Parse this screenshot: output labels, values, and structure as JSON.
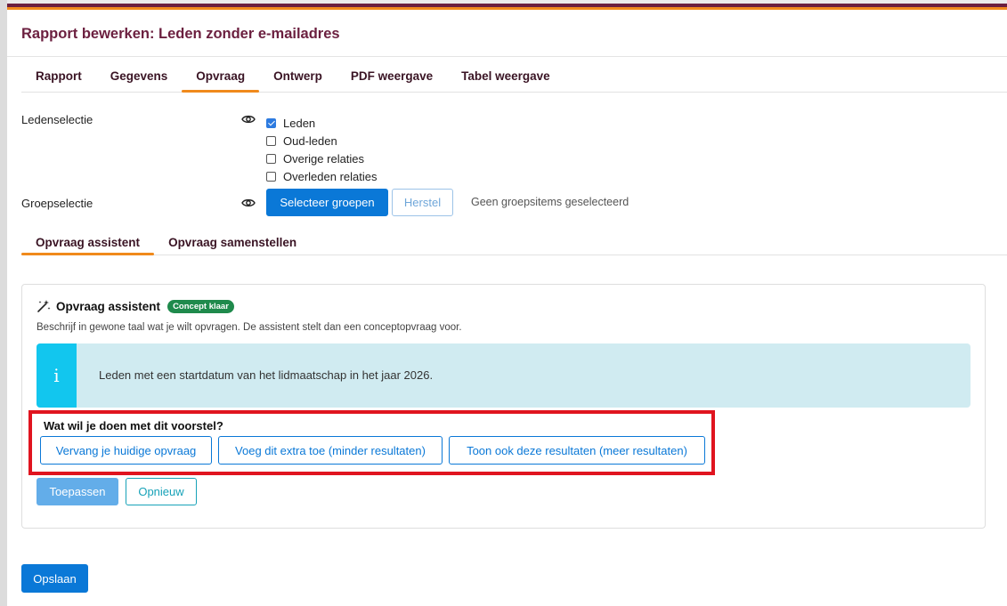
{
  "header": {
    "title": "Rapport bewerken: Leden zonder e-mailadres"
  },
  "tabs": [
    {
      "label": "Rapport"
    },
    {
      "label": "Gegevens"
    },
    {
      "label": "Opvraag",
      "active": true
    },
    {
      "label": "Ontwerp"
    },
    {
      "label": "PDF weergave"
    },
    {
      "label": "Tabel weergave"
    }
  ],
  "ledenselectie": {
    "label": "Ledenselectie",
    "options": [
      {
        "label": "Leden",
        "checked": true
      },
      {
        "label": "Oud-leden",
        "checked": false
      },
      {
        "label": "Overige relaties",
        "checked": false
      },
      {
        "label": "Overleden relaties",
        "checked": false
      }
    ]
  },
  "groepselectie": {
    "label": "Groepselectie",
    "select_button": "Selecteer groepen",
    "reset_button": "Herstel",
    "status": "Geen groepsitems geselecteerd"
  },
  "subtabs": [
    {
      "label": "Opvraag assistent",
      "active": true
    },
    {
      "label": "Opvraag samenstellen"
    }
  ],
  "assistant": {
    "title": "Opvraag assistent",
    "badge": "Concept klaar",
    "description": "Beschrijf in gewone taal wat je wilt opvragen. De assistent stelt dan een conceptopvraag voor.",
    "info_text": "Leden met een startdatum van het lidmaatschap in het jaar 2026.",
    "question": "Wat wil je doen met dit voorstel?",
    "choices": [
      "Vervang je huidige opvraag",
      "Voeg dit extra toe (minder resultaten)",
      "Toon ook deze resultaten (meer resultaten)"
    ],
    "apply_button": "Toepassen",
    "retry_button": "Opnieuw"
  },
  "save_button": "Opslaan",
  "colors": {
    "brand": "#6b1f3f",
    "accent": "#f08a1c",
    "primary": "#0a78d7",
    "info": "#12c6ee",
    "highlight": "#e0141f",
    "success": "#1f8a4c"
  }
}
